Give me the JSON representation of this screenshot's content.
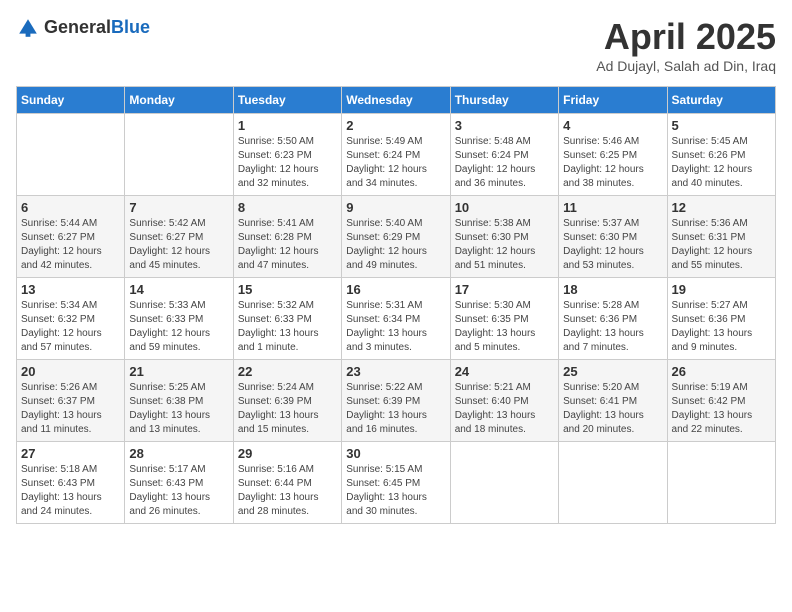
{
  "logo": {
    "text_general": "General",
    "text_blue": "Blue"
  },
  "header": {
    "month_year": "April 2025",
    "location": "Ad Dujayl, Salah ad Din, Iraq"
  },
  "weekdays": [
    "Sunday",
    "Monday",
    "Tuesday",
    "Wednesday",
    "Thursday",
    "Friday",
    "Saturday"
  ],
  "weeks": [
    [
      {
        "day": "",
        "info": ""
      },
      {
        "day": "",
        "info": ""
      },
      {
        "day": "1",
        "info": "Sunrise: 5:50 AM\nSunset: 6:23 PM\nDaylight: 12 hours and 32 minutes."
      },
      {
        "day": "2",
        "info": "Sunrise: 5:49 AM\nSunset: 6:24 PM\nDaylight: 12 hours and 34 minutes."
      },
      {
        "day": "3",
        "info": "Sunrise: 5:48 AM\nSunset: 6:24 PM\nDaylight: 12 hours and 36 minutes."
      },
      {
        "day": "4",
        "info": "Sunrise: 5:46 AM\nSunset: 6:25 PM\nDaylight: 12 hours and 38 minutes."
      },
      {
        "day": "5",
        "info": "Sunrise: 5:45 AM\nSunset: 6:26 PM\nDaylight: 12 hours and 40 minutes."
      }
    ],
    [
      {
        "day": "6",
        "info": "Sunrise: 5:44 AM\nSunset: 6:27 PM\nDaylight: 12 hours and 42 minutes."
      },
      {
        "day": "7",
        "info": "Sunrise: 5:42 AM\nSunset: 6:27 PM\nDaylight: 12 hours and 45 minutes."
      },
      {
        "day": "8",
        "info": "Sunrise: 5:41 AM\nSunset: 6:28 PM\nDaylight: 12 hours and 47 minutes."
      },
      {
        "day": "9",
        "info": "Sunrise: 5:40 AM\nSunset: 6:29 PM\nDaylight: 12 hours and 49 minutes."
      },
      {
        "day": "10",
        "info": "Sunrise: 5:38 AM\nSunset: 6:30 PM\nDaylight: 12 hours and 51 minutes."
      },
      {
        "day": "11",
        "info": "Sunrise: 5:37 AM\nSunset: 6:30 PM\nDaylight: 12 hours and 53 minutes."
      },
      {
        "day": "12",
        "info": "Sunrise: 5:36 AM\nSunset: 6:31 PM\nDaylight: 12 hours and 55 minutes."
      }
    ],
    [
      {
        "day": "13",
        "info": "Sunrise: 5:34 AM\nSunset: 6:32 PM\nDaylight: 12 hours and 57 minutes."
      },
      {
        "day": "14",
        "info": "Sunrise: 5:33 AM\nSunset: 6:33 PM\nDaylight: 12 hours and 59 minutes."
      },
      {
        "day": "15",
        "info": "Sunrise: 5:32 AM\nSunset: 6:33 PM\nDaylight: 13 hours and 1 minute."
      },
      {
        "day": "16",
        "info": "Sunrise: 5:31 AM\nSunset: 6:34 PM\nDaylight: 13 hours and 3 minutes."
      },
      {
        "day": "17",
        "info": "Sunrise: 5:30 AM\nSunset: 6:35 PM\nDaylight: 13 hours and 5 minutes."
      },
      {
        "day": "18",
        "info": "Sunrise: 5:28 AM\nSunset: 6:36 PM\nDaylight: 13 hours and 7 minutes."
      },
      {
        "day": "19",
        "info": "Sunrise: 5:27 AM\nSunset: 6:36 PM\nDaylight: 13 hours and 9 minutes."
      }
    ],
    [
      {
        "day": "20",
        "info": "Sunrise: 5:26 AM\nSunset: 6:37 PM\nDaylight: 13 hours and 11 minutes."
      },
      {
        "day": "21",
        "info": "Sunrise: 5:25 AM\nSunset: 6:38 PM\nDaylight: 13 hours and 13 minutes."
      },
      {
        "day": "22",
        "info": "Sunrise: 5:24 AM\nSunset: 6:39 PM\nDaylight: 13 hours and 15 minutes."
      },
      {
        "day": "23",
        "info": "Sunrise: 5:22 AM\nSunset: 6:39 PM\nDaylight: 13 hours and 16 minutes."
      },
      {
        "day": "24",
        "info": "Sunrise: 5:21 AM\nSunset: 6:40 PM\nDaylight: 13 hours and 18 minutes."
      },
      {
        "day": "25",
        "info": "Sunrise: 5:20 AM\nSunset: 6:41 PM\nDaylight: 13 hours and 20 minutes."
      },
      {
        "day": "26",
        "info": "Sunrise: 5:19 AM\nSunset: 6:42 PM\nDaylight: 13 hours and 22 minutes."
      }
    ],
    [
      {
        "day": "27",
        "info": "Sunrise: 5:18 AM\nSunset: 6:43 PM\nDaylight: 13 hours and 24 minutes."
      },
      {
        "day": "28",
        "info": "Sunrise: 5:17 AM\nSunset: 6:43 PM\nDaylight: 13 hours and 26 minutes."
      },
      {
        "day": "29",
        "info": "Sunrise: 5:16 AM\nSunset: 6:44 PM\nDaylight: 13 hours and 28 minutes."
      },
      {
        "day": "30",
        "info": "Sunrise: 5:15 AM\nSunset: 6:45 PM\nDaylight: 13 hours and 30 minutes."
      },
      {
        "day": "",
        "info": ""
      },
      {
        "day": "",
        "info": ""
      },
      {
        "day": "",
        "info": ""
      }
    ]
  ]
}
